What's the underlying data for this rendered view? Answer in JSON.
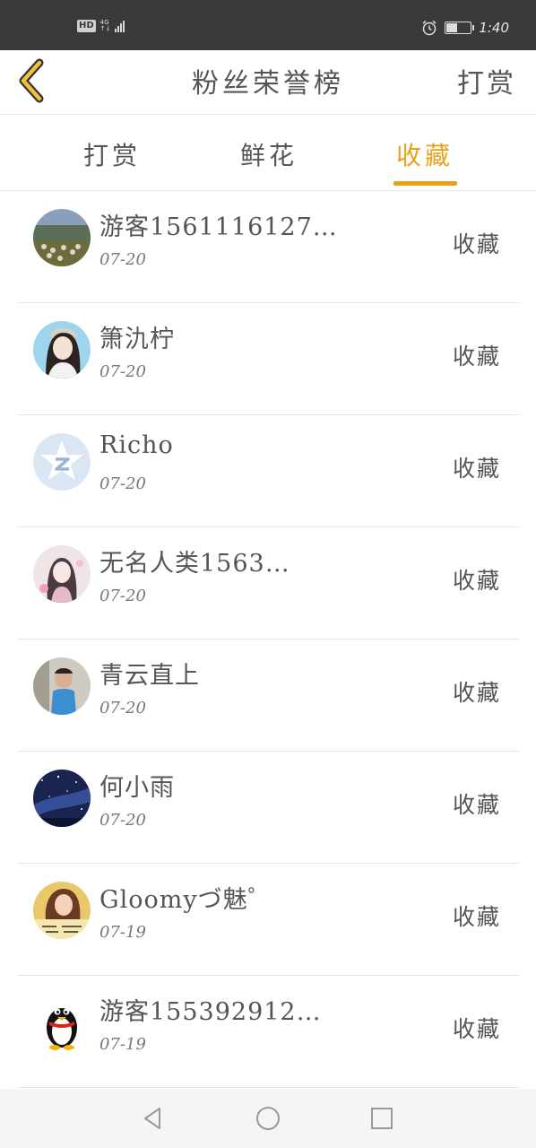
{
  "status_bar": {
    "hd_badge": "HD",
    "network_type": "4G",
    "network_arrows": "↑↓",
    "time": "1:40",
    "battery_level": 0.45,
    "icons": [
      "hd-icon",
      "signal-icon",
      "alarm-icon",
      "battery-icon"
    ]
  },
  "header": {
    "title": "粉丝荣誉榜",
    "action_label": "打赏",
    "back_icon": "chevron-left-icon",
    "accent_color": "#e8a21a"
  },
  "tabs": [
    {
      "label": "打赏",
      "active": false
    },
    {
      "label": "鲜花",
      "active": false
    },
    {
      "label": "收藏",
      "active": true
    }
  ],
  "list": [
    {
      "name": "游客1561116127…",
      "date": "07-20",
      "action": "收藏",
      "avatar": "landscape-avatar"
    },
    {
      "name": "箫氿柠",
      "date": "07-20",
      "action": "收藏",
      "avatar": "girl-portrait-avatar"
    },
    {
      "name": "Richo",
      "date": "07-20",
      "action": "收藏",
      "avatar": "default-star-avatar"
    },
    {
      "name": "无名人类1563…",
      "date": "07-20",
      "action": "收藏",
      "avatar": "anime-girl-avatar"
    },
    {
      "name": "青云直上",
      "date": "07-20",
      "action": "收藏",
      "avatar": "child-photo-avatar"
    },
    {
      "name": "何小雨",
      "date": "07-20",
      "action": "收藏",
      "avatar": "galaxy-avatar"
    },
    {
      "name": "Gloomyづ魅゜",
      "date": "07-19",
      "action": "收藏",
      "avatar": "portrait-text-avatar"
    },
    {
      "name": "游客155392912…",
      "date": "07-19",
      "action": "收藏",
      "avatar": "penguin-avatar"
    }
  ],
  "nav_bar": {
    "icons": [
      "back-triangle-icon",
      "home-circle-icon",
      "recents-square-icon"
    ]
  }
}
